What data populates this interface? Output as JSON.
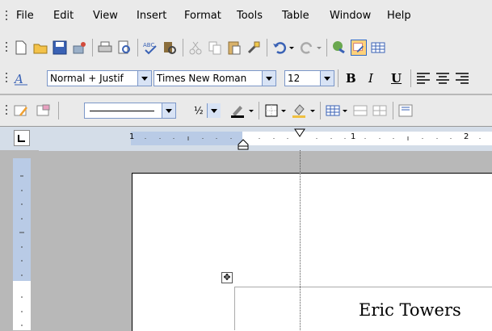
{
  "menubar": {
    "items": [
      "File",
      "Edit",
      "View",
      "Insert",
      "Format",
      "Tools",
      "Table",
      "Window",
      "Help"
    ]
  },
  "format_toolbar": {
    "style": "Normal + Justif",
    "font": "Times New Roman",
    "size": "12",
    "bold": "B",
    "italic": "I",
    "underline": "U"
  },
  "drawing_toolbar": {
    "line_weight": "½"
  },
  "ruler": {
    "labels": [
      "1",
      "1",
      "2"
    ]
  },
  "document": {
    "text": "Eric Towers"
  },
  "colors": {
    "toolbar_bg": "#eaeaea",
    "margin_blue": "#b9cbe6",
    "accent_blue": "#316ac5"
  }
}
